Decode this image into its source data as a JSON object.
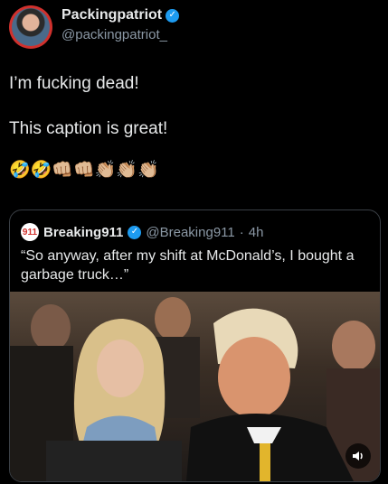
{
  "author": {
    "display_name": "Packingpatriot",
    "handle": "@packingpatriot_",
    "verified_icon": "verified-badge-icon"
  },
  "post": {
    "line1": "I’m fucking dead!",
    "line2": "This caption is great!",
    "emojis": "🤣🤣👊🏼👊🏼👏🏼👏🏼👏🏼"
  },
  "quoted": {
    "logo_text": "911",
    "display_name": "Breaking911",
    "handle": "@Breaking911",
    "separator": "·",
    "time": "4h",
    "text": "“So anyway, after my shift at McDonald’s, I bought a garbage truck…”"
  },
  "media": {
    "audio_icon": "speaker-icon"
  },
  "colors": {
    "background": "#000000",
    "text": "#e7e9ea",
    "muted": "#8b98a5",
    "verified": "#1d9bf0",
    "border": "#3a3f45",
    "logo_red": "#d0312d"
  }
}
